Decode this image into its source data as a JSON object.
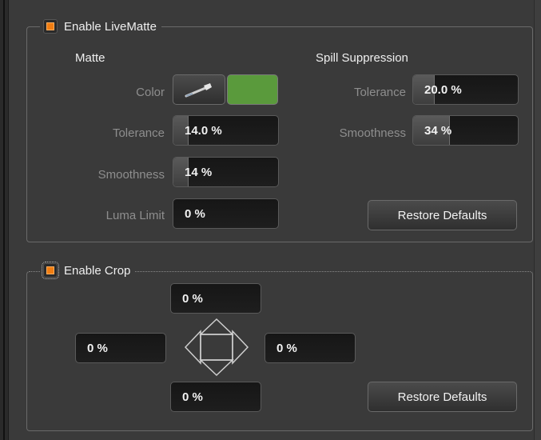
{
  "livematte": {
    "enable_label": "Enable LiveMatte",
    "enabled": true,
    "matte": {
      "heading": "Matte",
      "color_label": "Color",
      "eyedropper_icon": "eyedropper-icon",
      "color_value": "#5a9a3c",
      "tolerance_label": "Tolerance",
      "tolerance_value": "14.0 %",
      "tolerance_fraction": 0.14,
      "smoothness_label": "Smoothness",
      "smoothness_value": "14 %",
      "smoothness_fraction": 0.14,
      "luma_limit_label": "Luma Limit",
      "luma_limit_value": "0 %",
      "luma_limit_fraction": 0.0
    },
    "spill": {
      "heading": "Spill Suppression",
      "tolerance_label": "Tolerance",
      "tolerance_value": "20.0 %",
      "tolerance_fraction": 0.2,
      "smoothness_label": "Smoothness",
      "smoothness_value": "34 %",
      "smoothness_fraction": 0.34
    },
    "restore_label": "Restore Defaults"
  },
  "crop": {
    "enable_label": "Enable Crop",
    "enabled": true,
    "top_value": "0 %",
    "left_value": "0 %",
    "right_value": "0 %",
    "bottom_value": "0 %",
    "dpad_icon": "crop-direction-pad-icon",
    "restore_label": "Restore Defaults"
  },
  "colors": {
    "accent": "#f07d12",
    "background": "#3a3a3a",
    "field_bg": "#1a1a1a",
    "label_text": "#8e8e8e"
  }
}
